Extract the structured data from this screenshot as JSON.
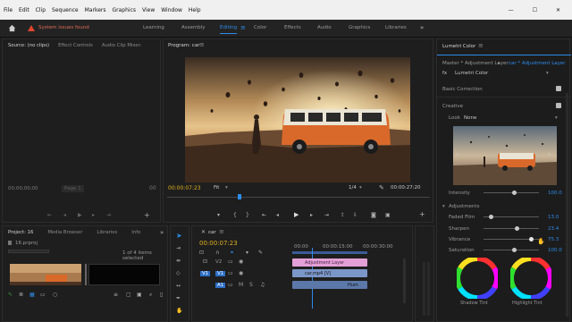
{
  "menu": {
    "items": [
      "File",
      "Edit",
      "Clip",
      "Sequence",
      "Markers",
      "Graphics",
      "View",
      "Window",
      "Help"
    ],
    "controls": [
      "—",
      "☐",
      "✕"
    ]
  },
  "workspace": {
    "warning": "System issues found",
    "tabs": [
      "Learning",
      "Assembly",
      "Editing",
      "Color",
      "Effects",
      "Audio",
      "Graphics",
      "Libraries"
    ],
    "active": "Editing"
  },
  "source": {
    "tabs": [
      "Source: (no clips)",
      "Effect Controls",
      "Audio Clip Mixer:"
    ],
    "timecode": "00;00;00;00",
    "page": "Page 1"
  },
  "program": {
    "title": "Program: car",
    "timecode": "00:00:07:23",
    "fit": "Fit",
    "ratio": "1/4",
    "duration": "00:00:27:20"
  },
  "project": {
    "tabs": [
      "Project: 16",
      "Media Browser",
      "Libraries",
      "Info"
    ],
    "file": "16.prproj",
    "count": "1 of 4 items selected"
  },
  "timeline": {
    "tab": "car",
    "timecode": "00:00:07:23",
    "ruler": [
      "00:00",
      "00:00:15:00",
      "00:00:30:00"
    ],
    "tracks": [
      "V2",
      "V1",
      "A1"
    ],
    "clips": [
      "Adjustment Layer",
      "car.mp4 [V]",
      "Hum"
    ]
  },
  "lumetri": {
    "title": "Lumetri Color",
    "master": "Master * Adjustment Layer",
    "seq": "car * Adjustment Layer",
    "fx": "Lumetri Color",
    "basic": "Basic Correction",
    "creative": "Creative",
    "look_label": "Look",
    "look_value": "None",
    "intensity_label": "Intensity",
    "intensity_value": "100.0",
    "intensity": 0.56,
    "adjustments": "Adjustments",
    "faded_label": "Faded Film",
    "faded_value": "13.0",
    "faded": 0.14,
    "sharpen_label": "Sharpen",
    "sharpen_value": "23.4",
    "sharpen": 0.6,
    "vibrance_label": "Vibrance",
    "vibrance_value": "75.3",
    "vibrance": 0.86,
    "saturation_label": "Saturation",
    "saturation_value": "100.0",
    "saturation": 0.55,
    "wheels": [
      "Shadow Tint",
      "Highlight Tint"
    ]
  },
  "colors": {
    "accent": "#2d8ceb",
    "adjustment_clip": "#e3a0d6",
    "video_clip": "#7b96c8",
    "audio_clip": "#5b78a8",
    "warning": "#e0452b"
  }
}
